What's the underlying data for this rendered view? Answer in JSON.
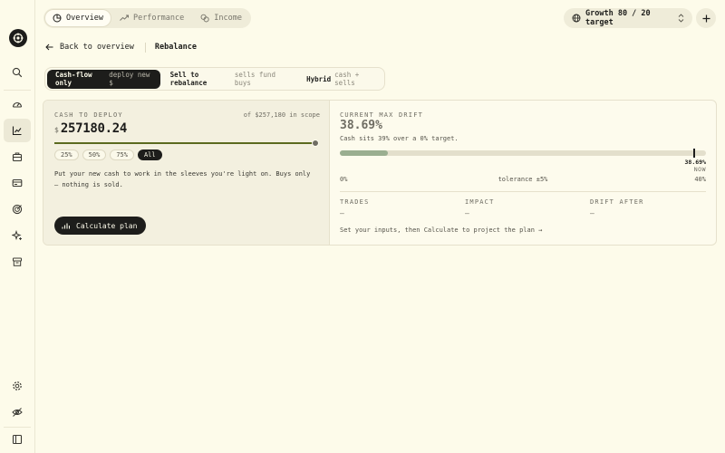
{
  "nav": {
    "tabs": [
      {
        "label": "Overview",
        "icon": "pie-chart-icon",
        "active": true
      },
      {
        "label": "Performance",
        "icon": "trend-line-icon",
        "active": false
      },
      {
        "label": "Income",
        "icon": "coins-icon",
        "active": false
      }
    ]
  },
  "profile": {
    "label": "Growth 80 / 20 target",
    "icon": "globe-icon"
  },
  "sidebar": {
    "items": [
      {
        "name": "search",
        "icon": "search-icon"
      },
      {
        "name": "dashboard",
        "icon": "gauge-icon"
      },
      {
        "name": "analytics",
        "icon": "line-chart-icon",
        "active": true
      },
      {
        "name": "holdings",
        "icon": "briefcase-icon"
      },
      {
        "name": "accounts",
        "icon": "card-icon"
      },
      {
        "name": "goals",
        "icon": "target-icon"
      },
      {
        "name": "insights",
        "icon": "sparkle-icon"
      },
      {
        "name": "archive",
        "icon": "archive-icon"
      },
      {
        "name": "settings",
        "icon": "gear-icon"
      },
      {
        "name": "privacy",
        "icon": "eye-off-icon"
      },
      {
        "name": "collapse",
        "icon": "sidebar-toggle-icon"
      }
    ]
  },
  "header": {
    "back_label": "Back to overview",
    "title": "Rebalance"
  },
  "modes": [
    {
      "label": "Cash-flow only",
      "sub": "deploy new $",
      "active": true
    },
    {
      "label": "Sell to rebalance",
      "sub": "sells fund buys",
      "active": false
    },
    {
      "label": "Hybrid",
      "sub": "cash + sells",
      "active": false
    }
  ],
  "cash": {
    "kicker": "CASH TO DEPLOY",
    "scope": "of $257,180 in scope",
    "currency": "$",
    "amount": "257180.24",
    "slider_fraction": 1.0,
    "presets": [
      {
        "label": "25%",
        "active": false
      },
      {
        "label": "50%",
        "active": false
      },
      {
        "label": "75%",
        "active": false
      },
      {
        "label": "All",
        "active": true
      }
    ],
    "description": "Put your new cash to work in the sleeves you're light on. Buys only — nothing is sold.",
    "button_label": "Calculate plan"
  },
  "drift": {
    "kicker": "CURRENT MAX DRIFT",
    "value": "38.69%",
    "note": "Cash sits 39% over a 0% target.",
    "fill_fraction": 0.13,
    "marker_fraction": 0.967,
    "now_value": "38.69%",
    "now_label": "NOW",
    "scale_min": "0%",
    "tolerance": "tolerance ±5%",
    "scale_max": "40%",
    "colors": {
      "fill": "#9aae90",
      "track": "#e3dfcc"
    }
  },
  "stats": [
    {
      "label": "TRADES",
      "value": "—"
    },
    {
      "label": "IMPACT",
      "value": "—"
    },
    {
      "label": "DRIFT AFTER",
      "value": "—"
    }
  ],
  "footnote": "Set your inputs, then Calculate to project the plan →"
}
